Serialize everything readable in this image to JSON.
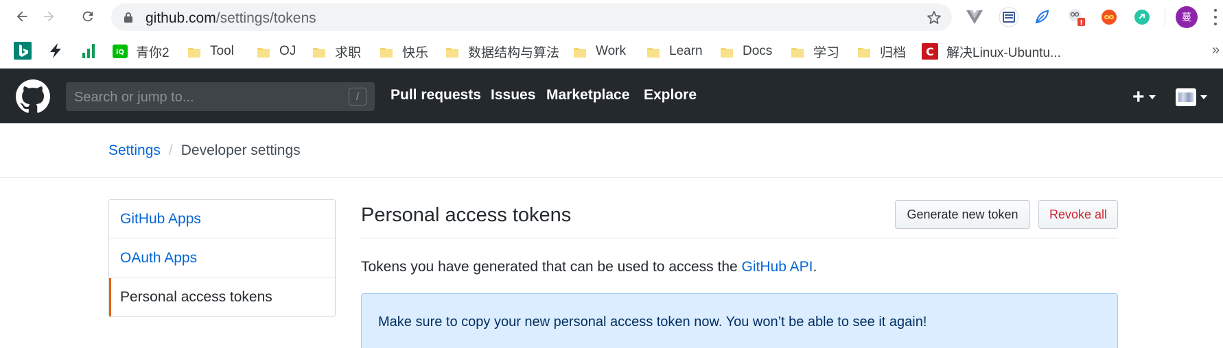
{
  "browser": {
    "url_host": "github.com",
    "url_path": "/settings/tokens",
    "profile_initial": "蔓",
    "bookmarks": [
      {
        "label": "青你2",
        "kind": "iqiyi"
      },
      {
        "label": "Tool",
        "kind": "folder"
      },
      {
        "label": "OJ",
        "kind": "folder"
      },
      {
        "label": "求职",
        "kind": "folder"
      },
      {
        "label": "快乐",
        "kind": "folder"
      },
      {
        "label": "数据结构与算法",
        "kind": "folder"
      },
      {
        "label": "Work",
        "kind": "folder"
      },
      {
        "label": "Learn",
        "kind": "folder"
      },
      {
        "label": "Docs",
        "kind": "folder"
      },
      {
        "label": "学习",
        "kind": "folder"
      },
      {
        "label": "归档",
        "kind": "folder"
      },
      {
        "label": "解决Linux-Ubuntu...",
        "kind": "csdn"
      }
    ],
    "overflow": "»"
  },
  "header": {
    "search_placeholder": "Search or jump to...",
    "search_key": "/",
    "nav": [
      "Pull requests",
      "Issues",
      "Marketplace",
      "Explore"
    ],
    "plus": "+"
  },
  "breadcrumb": {
    "root": "Settings",
    "separator": "/",
    "current": "Developer settings"
  },
  "sidebar": {
    "items": [
      {
        "label": "GitHub Apps",
        "selected": false
      },
      {
        "label": "OAuth Apps",
        "selected": false
      },
      {
        "label": "Personal access tokens",
        "selected": true
      }
    ]
  },
  "main": {
    "title": "Personal access tokens",
    "generate_button": "Generate new token",
    "revoke_button": "Revoke all",
    "description_prefix": "Tokens you have generated that can be used to access the ",
    "description_link": "GitHub API",
    "description_suffix": ".",
    "flash_message": "Make sure to copy your new personal access token now. You won’t be able to see it again!"
  },
  "colors": {
    "header_bg": "#24292e",
    "link": "#0366d6",
    "danger": "#cb2431",
    "selected_accent": "#e36209",
    "flash_bg": "#dbedff"
  }
}
